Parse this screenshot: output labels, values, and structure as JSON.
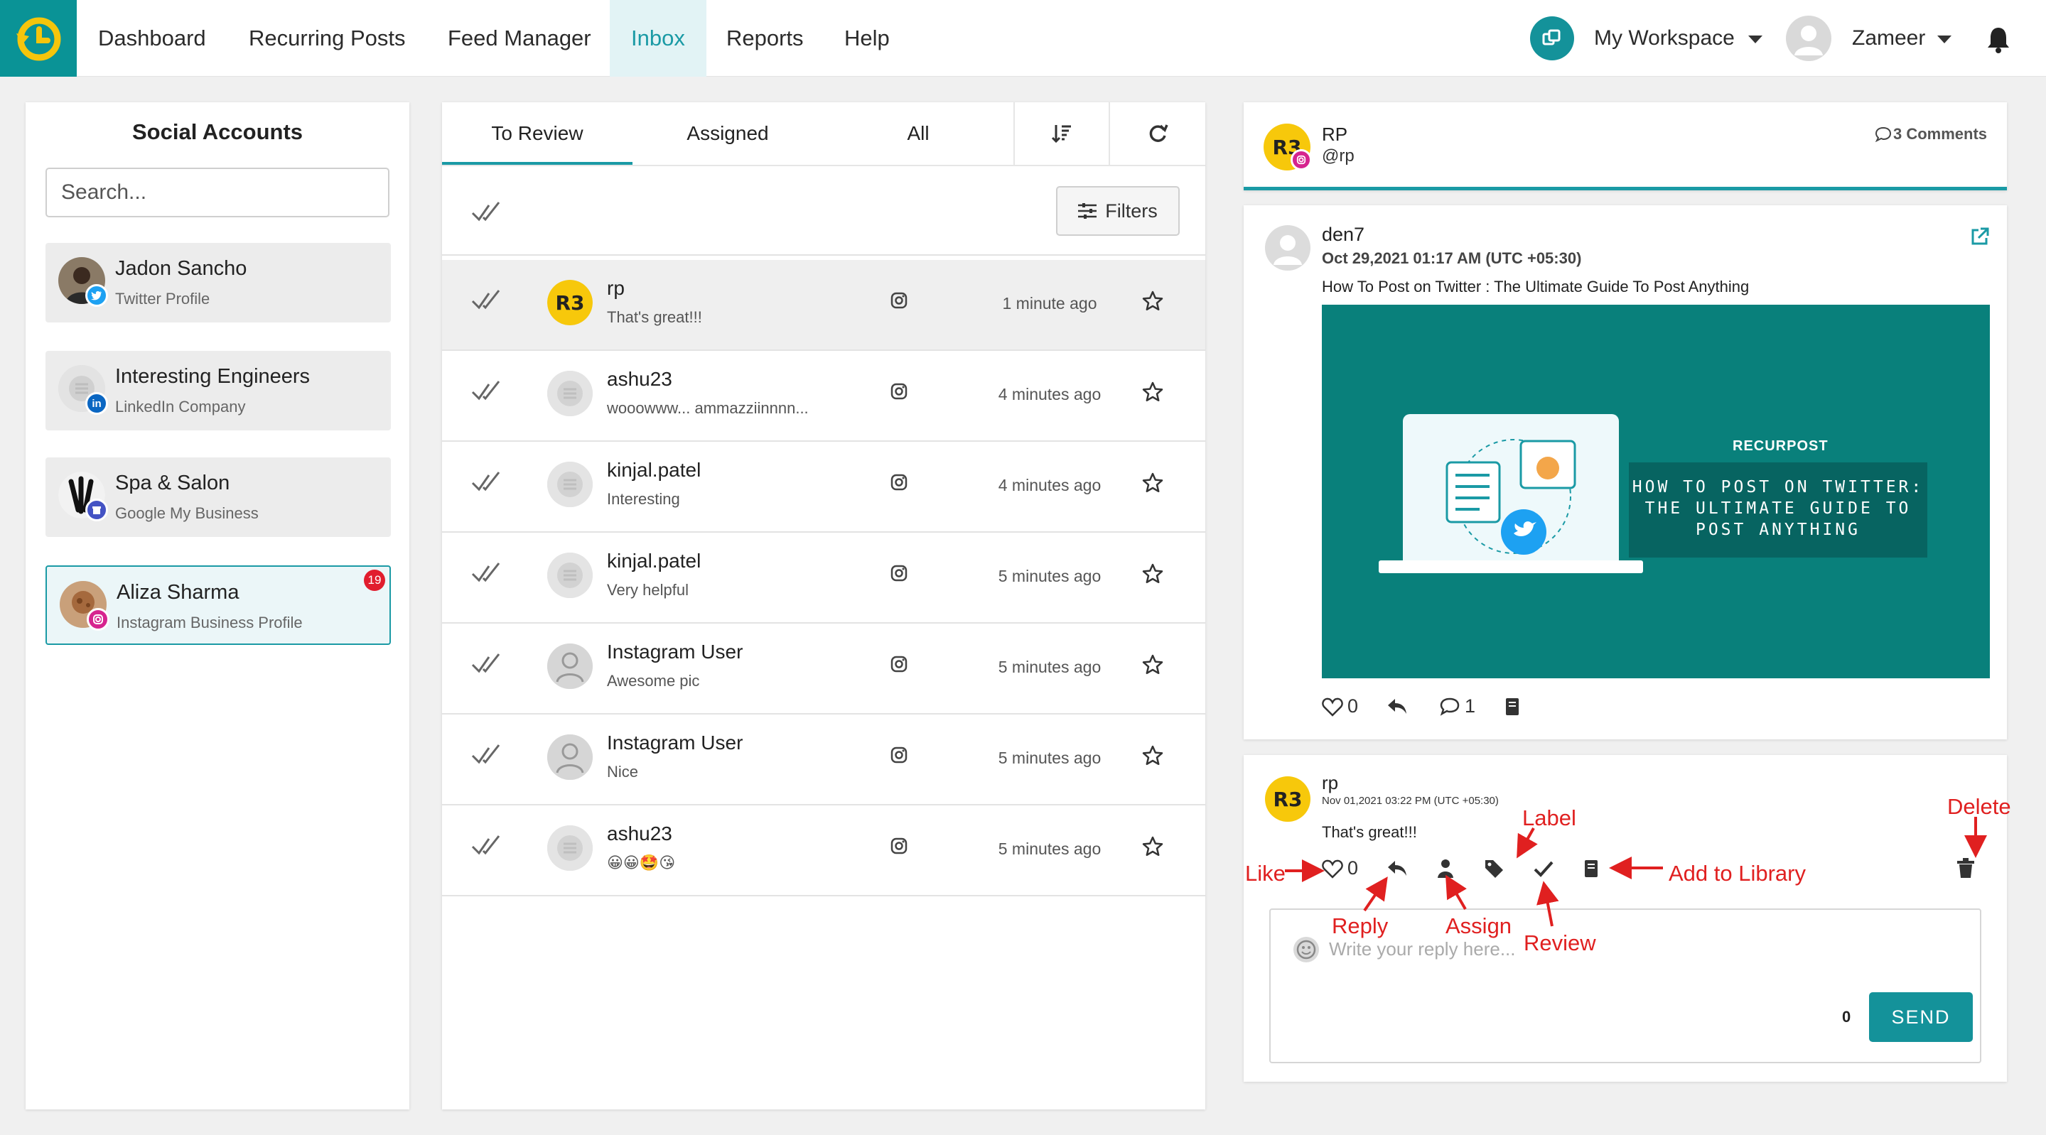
{
  "nav": {
    "items": [
      "Dashboard",
      "Recurring Posts",
      "Feed Manager",
      "Inbox",
      "Reports",
      "Help"
    ],
    "active": "Inbox",
    "workspace": "My Workspace",
    "user": "Zameer"
  },
  "accounts": {
    "title": "Social Accounts",
    "search_placeholder": "Search...",
    "items": [
      {
        "name": "Jadon Sancho",
        "type": "Twitter Profile",
        "network": "twitter"
      },
      {
        "name": "Interesting Engineers",
        "type": "LinkedIn Company",
        "network": "linkedin"
      },
      {
        "name": "Spa & Salon",
        "type": "Google My Business",
        "network": "google-my-business"
      },
      {
        "name": "Aliza Sharma",
        "type": "Instagram Business Profile",
        "network": "instagram",
        "count": "19",
        "selected": true
      }
    ]
  },
  "inbox": {
    "tabs": [
      "To Review",
      "Assigned",
      "All"
    ],
    "active_tab": "To Review",
    "filters_label": "Filters",
    "rows": [
      {
        "name": "rp",
        "message": "That's great!!!",
        "time": "1 minute ago",
        "avatar": "r3"
      },
      {
        "name": "ashu23",
        "message": "wooowww... ammazziinnnn...",
        "time": "4 minutes ago",
        "avatar": "generic"
      },
      {
        "name": "kinjal.patel",
        "message": "Interesting",
        "time": "4 minutes ago",
        "avatar": "generic"
      },
      {
        "name": "kinjal.patel",
        "message": "Very helpful",
        "time": "5 minutes ago",
        "avatar": "generic"
      },
      {
        "name": "Instagram User",
        "message": "Awesome pic",
        "time": "5 minutes ago",
        "avatar": "user"
      },
      {
        "name": "Instagram User",
        "message": "Nice",
        "time": "5 minutes ago",
        "avatar": "user"
      },
      {
        "name": "ashu23",
        "message": "😀😀🤩😘",
        "time": "5 minutes ago",
        "avatar": "generic"
      }
    ]
  },
  "thread": {
    "account_name": "RP",
    "account_handle": "@rp",
    "comments_count": "3 Comments"
  },
  "post": {
    "author": "den7",
    "date": "Oct 29,2021 01:17 AM (UTC +05:30)",
    "text": "How To Post on Twitter : The Ultimate Guide To Post Anything",
    "image_brand": "RECURPOST",
    "image_title": "HOW TO POST ON TWITTER: THE ULTIMATE GUIDE TO POST ANYTHING",
    "likes": "0",
    "comments": "1"
  },
  "comment": {
    "author": "rp",
    "date": "Nov 01,2021 03:22 PM (UTC +05:30)",
    "text": "That's great!!!",
    "likes": "0",
    "reply_placeholder": "Write your reply here...",
    "char_count": "0",
    "send_label": "SEND"
  },
  "annotations": {
    "like": "Like",
    "reply": "Reply",
    "assign": "Assign",
    "label": "Label",
    "review": "Review",
    "add_to_library": "Add to Library",
    "delete": "Delete"
  },
  "colors": {
    "accent": "#1a9aa5",
    "brand_teal": "#0a9396",
    "annotation": "#e02020",
    "badge": "#e11d2e"
  }
}
